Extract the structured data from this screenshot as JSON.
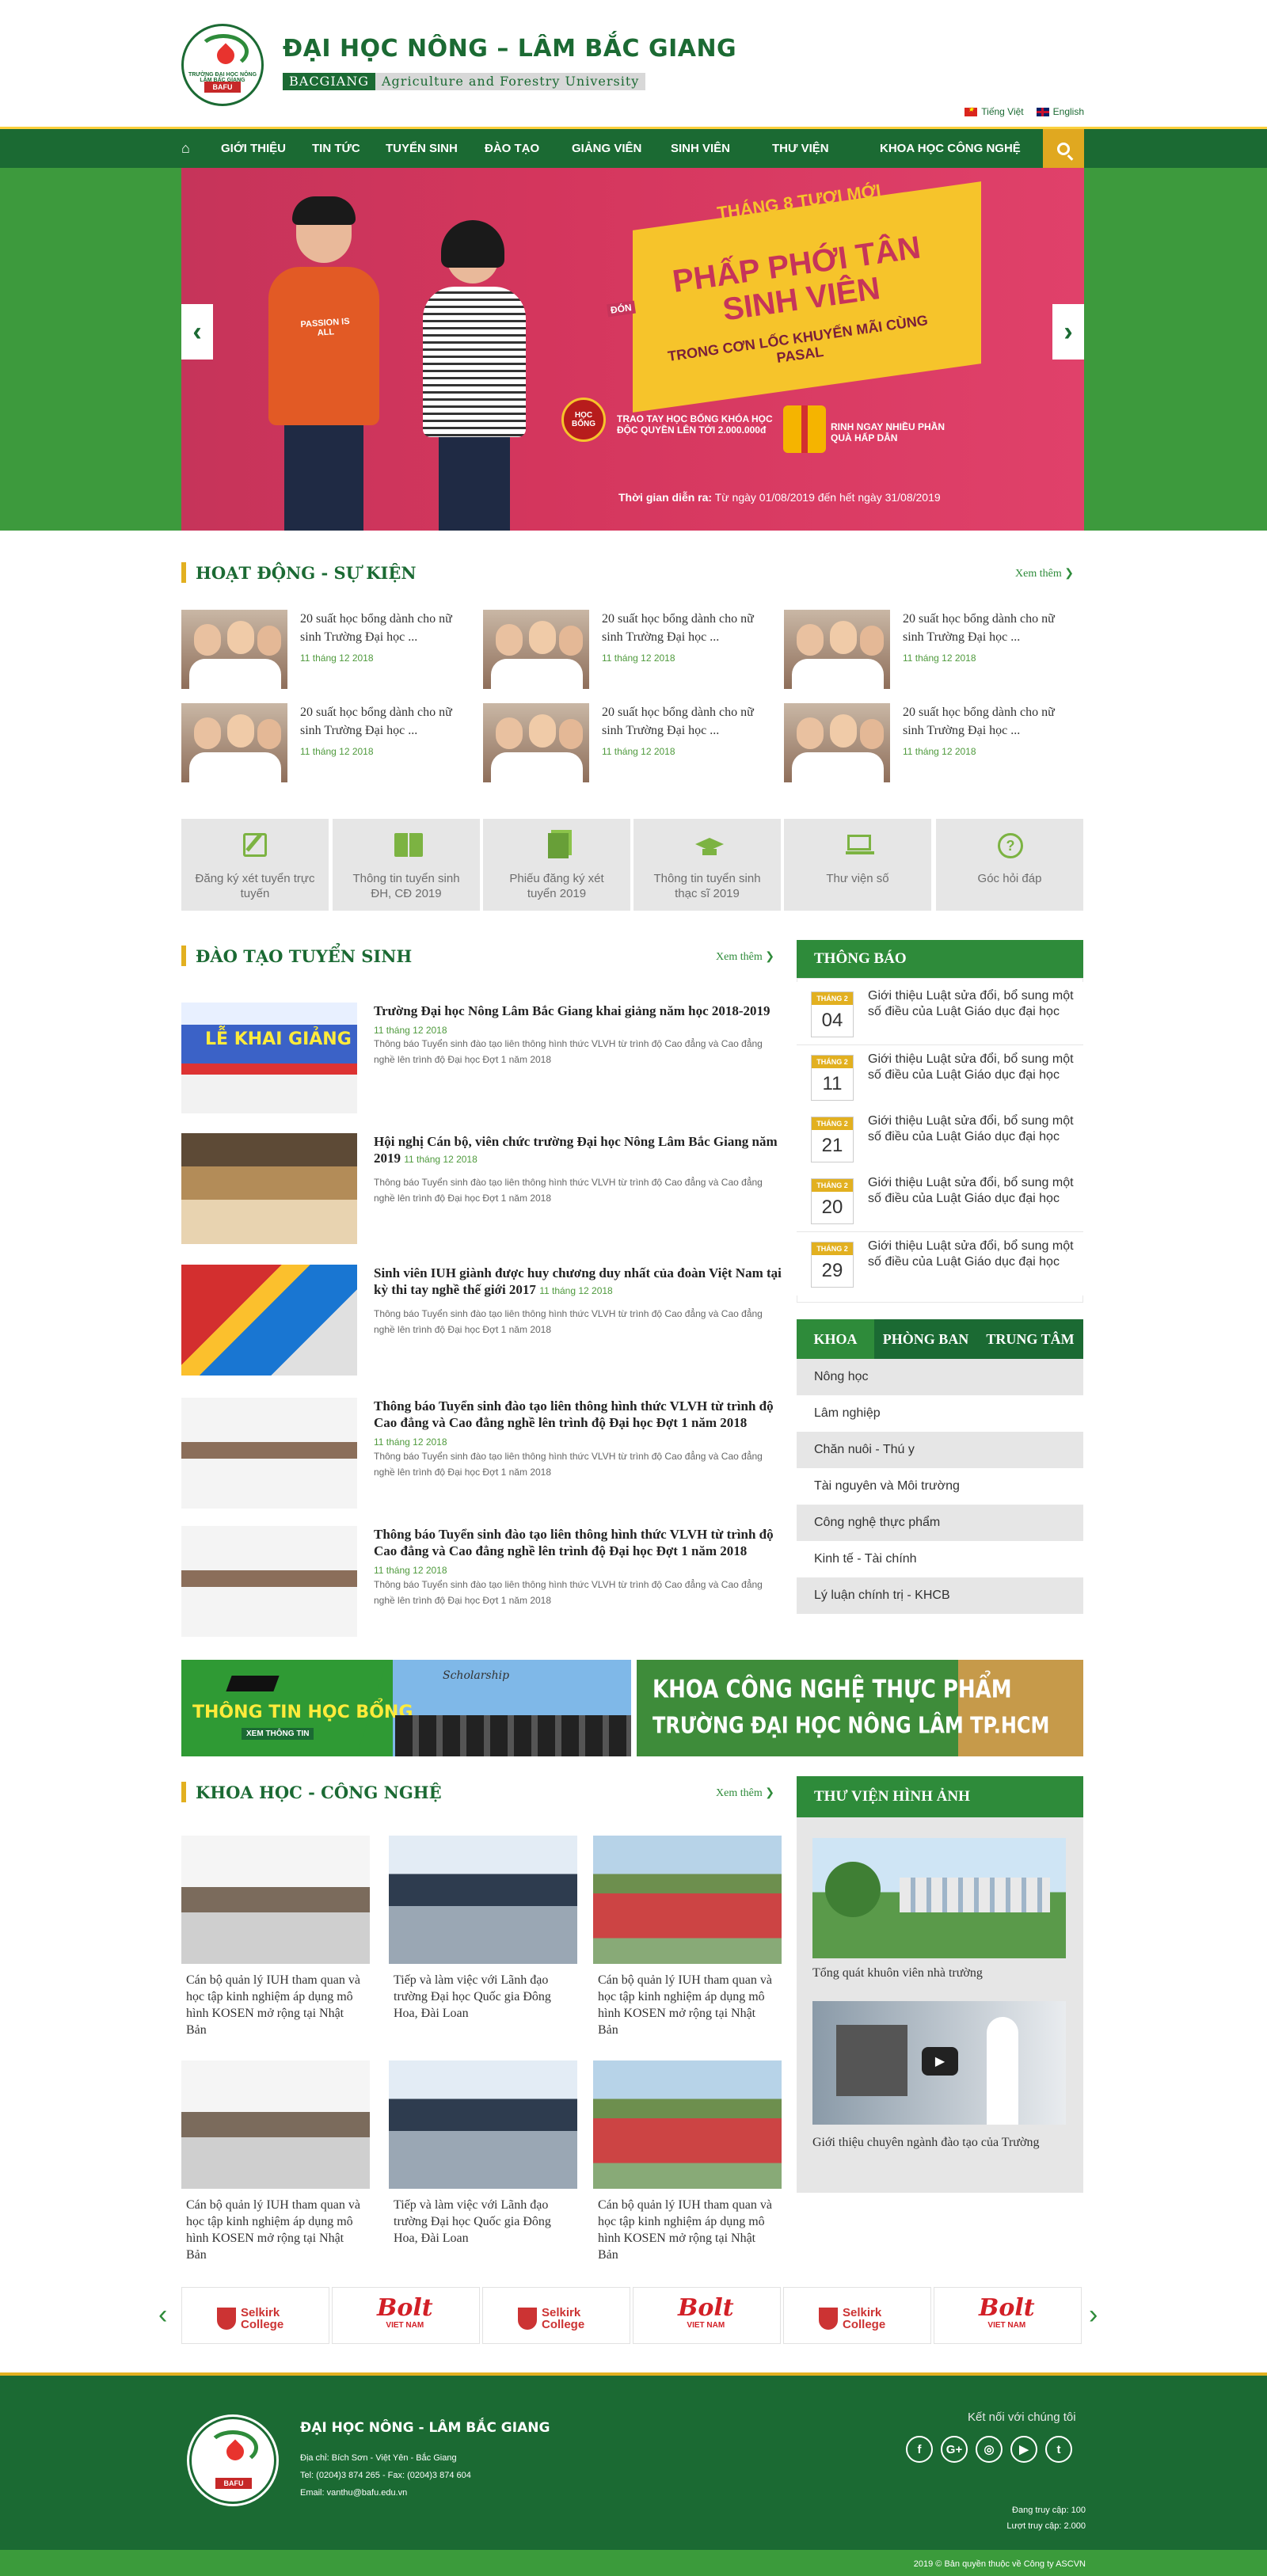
{
  "header": {
    "title": "ĐẠI HỌC NÔNG – LÂM BẮC GIANG",
    "subtitle_key": "BACGIANG",
    "subtitle_value": "Agriculture and Forestry University",
    "logo_text": "TRƯỜNG ĐẠI HỌC NÔNG LÂM BẮC GIANG",
    "logo_badge": "BAFU",
    "languages": [
      {
        "label": "Tiếng Việt",
        "icon": "vn-flag-icon"
      },
      {
        "label": "English",
        "icon": "uk-flag-icon"
      }
    ]
  },
  "nav": {
    "items": [
      "GIỚI THIỆU",
      "TIN TỨC",
      "TUYỂN SINH",
      "ĐÀO TẠO",
      "GIẢNG VIÊN",
      "SINH VIÊN",
      "THƯ VIỆN",
      "KHOA HỌC CÔNG NGHỆ"
    ],
    "colors": {
      "bar": "#1b6a33",
      "accent": "#e0a820"
    }
  },
  "slider": {
    "line1": "THÁNG 8 TƯƠI MỚI",
    "line2": "PHẤP PHỚI TÂN SINH VIÊN",
    "line2_prefix": "ĐÓN",
    "line3": "TRONG CƠN LỐC KHUYẾN MÃI CÙNG PASAL",
    "promo1": "TRAO TAY HỌC BỔNG KHÓA HỌC ĐỘC QUYỀN LÊN TỚI 2.000.000đ",
    "promo2": "RINH NGAY NHIỀU PHẦN QUÀ HẤP DẪN",
    "shirt_text": "PASSION IS ALL",
    "seal_text": "HỌC BỔNG",
    "time_label": "Thời gian diễn ra:",
    "time_value": "Từ ngày 01/08/2019 đến hết ngày 31/08/2019"
  },
  "events": {
    "heading": "HOẠT ĐỘNG - SỰ KIỆN",
    "more": "Xem thêm",
    "items": [
      {
        "title": "20 suất học bổng dành cho nữ sinh Trường Đại học ...",
        "date": "11 tháng 12 2018"
      },
      {
        "title": "20 suất học bổng dành cho nữ sinh Trường Đại học ...",
        "date": "11 tháng 12 2018"
      },
      {
        "title": "20 suất học bổng dành cho nữ sinh Trường Đại học ...",
        "date": "11 tháng 12 2018"
      },
      {
        "title": "20 suất học bổng dành cho nữ sinh Trường Đại học ...",
        "date": "11 tháng 12 2018"
      },
      {
        "title": "20 suất học bổng dành cho nữ sinh Trường Đại học ...",
        "date": "11 tháng 12 2018"
      },
      {
        "title": "20 suất học bổng dành cho nữ sinh Trường Đại học ...",
        "date": "11 tháng 12 2018"
      }
    ]
  },
  "quick_links": [
    {
      "label": "Đăng ký xét tuyển trực tuyến",
      "icon": "edit-icon"
    },
    {
      "label": "Thông tin tuyển sinh ĐH, CĐ 2019",
      "icon": "book-icon"
    },
    {
      "label": "Phiếu đăng ký xét tuyển 2019",
      "icon": "books-icon"
    },
    {
      "label": "Thông tin tuyển sinh thạc sĩ 2019",
      "icon": "graduation-cap-icon"
    },
    {
      "label": "Thư viện số",
      "icon": "laptop-icon"
    },
    {
      "label": "Góc hỏi đáp",
      "icon": "question-icon"
    }
  ],
  "training": {
    "heading": "ĐÀO TẠO TUYỂN SINH",
    "more": "Xem thêm",
    "items": [
      {
        "title": "Trường Đại học Nông Lâm Bắc Giang khai giảng năm học 2018-2019",
        "date": "11 tháng 12 2018",
        "desc": "Thông báo Tuyển sinh đào tạo liên thông hình thức VLVH từ trình độ Cao đẳng và Cao đẳng nghề lên trình độ Đại học Đợt 1 năm 2018"
      },
      {
        "title": "Hội nghị Cán bộ, viên chức trường Đại học Nông Lâm Bắc Giang năm 2019",
        "date": "11 tháng 12 2018",
        "desc": "Thông báo Tuyển sinh đào tạo liên thông hình thức VLVH từ trình độ Cao đẳng và Cao đẳng nghề lên trình độ Đại học Đợt 1 năm 2018"
      },
      {
        "title": "Sinh viên IUH giành được huy chương duy nhất của đoàn Việt Nam tại kỳ thi tay nghề thế giới 2017",
        "date": "11 tháng 12 2018",
        "desc": "Thông báo Tuyển sinh đào tạo liên thông hình thức VLVH từ trình độ Cao đẳng và Cao đẳng nghề lên trình độ Đại học Đợt 1 năm 2018"
      },
      {
        "title": "Thông báo Tuyển sinh đào tạo liên thông hình thức VLVH từ trình độ Cao đẳng và Cao đẳng nghề lên trình độ Đại học Đợt 1 năm 2018",
        "date": "11 tháng 12 2018",
        "desc": "Thông báo Tuyển sinh đào tạo liên thông hình thức VLVH từ trình độ Cao đẳng và Cao đẳng nghề lên trình độ Đại học Đợt 1 năm 2018"
      },
      {
        "title": "Thông báo Tuyển sinh đào tạo liên thông hình thức VLVH từ trình độ Cao đẳng và Cao đẳng nghề lên trình độ Đại học Đợt 1 năm 2018",
        "date": "11 tháng 12 2018",
        "desc": "Thông báo Tuyển sinh đào tạo liên thông hình thức VLVH từ trình độ Cao đẳng và Cao đẳng nghề lên trình độ Đại học Đợt 1 năm 2018"
      }
    ],
    "slide_title": "LỄ KHAI GIẢNG"
  },
  "notices": {
    "heading": "THÔNG BÁO",
    "items": [
      {
        "month": "THÁNG 2",
        "day": "04",
        "text": "Giới thiệu Luật sửa đổi, bổ sung một số điều của Luật Giáo dục đại học"
      },
      {
        "month": "THÁNG 2",
        "day": "11",
        "text": "Giới thiệu Luật sửa đổi, bổ sung một số điều của Luật Giáo dục đại học"
      },
      {
        "month": "THÁNG 2",
        "day": "21",
        "text": "Giới thiệu Luật sửa đổi, bổ sung một số điều của Luật Giáo dục đại học"
      },
      {
        "month": "THÁNG 2",
        "day": "20",
        "text": "Giới thiệu Luật sửa đổi, bổ sung một số điều của Luật Giáo dục đại học"
      },
      {
        "month": "THÁNG 2",
        "day": "29",
        "text": "Giới thiệu Luật sửa đổi, bổ sung một số điều của Luật Giáo dục đại học"
      }
    ]
  },
  "faculty_tabs": {
    "tabs": [
      "KHOA",
      "PHÒNG BAN",
      "TRUNG TÂM"
    ],
    "items": [
      "Nông học",
      "Lâm nghiệp",
      "Chăn nuôi - Thú y",
      "Tài nguyên và Môi trường",
      "Công nghệ thực phẩm",
      "Kinh tế - Tài chính",
      "Lý luận chính trị - KHCB"
    ]
  },
  "ad_banners": {
    "left_title": "THÔNG TIN HỌC BỔNG",
    "left_sub": "XEM THÔNG TIN",
    "left_brand": "Scholarship",
    "right_line1": "KHOA CÔNG NGHỆ THỰC PHẨM",
    "right_line2": "TRƯỜNG ĐẠI HỌC NÔNG LÂM TP.HCM"
  },
  "science": {
    "heading": "KHOA HỌC - CÔNG NGHỆ",
    "more": "Xem thêm",
    "items": [
      {
        "title": "Cán bộ quản lý IUH tham quan và học tập kinh nghiệm áp dụng mô hình KOSEN mở rộng tại Nhật Bản"
      },
      {
        "title": "Tiếp và làm việc với Lãnh đạo trường Đại học Quốc gia Đông Hoa, Đài Loan"
      },
      {
        "title": "Cán bộ quản lý IUH tham quan và học tập kinh nghiệm áp dụng mô hình KOSEN mở rộng tại Nhật Bản"
      },
      {
        "title": "Cán bộ quản lý IUH tham quan và học tập kinh nghiệm áp dụng mô hình KOSEN mở rộng tại Nhật Bản"
      },
      {
        "title": "Tiếp và làm việc với Lãnh đạo trường Đại học Quốc gia Đông Hoa, Đài Loan"
      },
      {
        "title": "Cán bộ quản lý IUH tham quan và học tập kinh nghiệm áp dụng mô hình KOSEN mở rộng tại Nhật Bản"
      }
    ]
  },
  "gallery": {
    "heading": "THƯ VIỆN HÌNH ẢNH",
    "items": [
      {
        "title": "Tổng quát khuôn viên nhà trường"
      },
      {
        "title": "Giới thiệu chuyên ngành đào tạo của Trường"
      }
    ]
  },
  "partners": {
    "items": [
      {
        "brand": "Selkirk College",
        "line1": "Selkirk",
        "line2": "College"
      },
      {
        "brand": "Bolt Việt Nam",
        "line1": "Bolt",
        "line2": "VIET NAM"
      },
      {
        "brand": "Selkirk College",
        "line1": "Selkirk",
        "line2": "College"
      },
      {
        "brand": "Bolt Việt Nam",
        "line1": "Bolt",
        "line2": "VIET NAM"
      },
      {
        "brand": "Selkirk College",
        "line1": "Selkirk",
        "line2": "College"
      },
      {
        "brand": "Bolt Việt Nam",
        "line1": "Bolt",
        "line2": "VIET NAM"
      }
    ]
  },
  "footer": {
    "title": "ĐẠI HỌC NÔNG - LÂM BẮC GIANG",
    "address": "Địa chỉ: Bích Sơn - Việt Yên - Bắc Giang",
    "phone": "Tel: (0204)3 874 265 - Fax: (0204)3 874 604",
    "email": "Email: vanthu@bafu.edu.vn",
    "connect": "Kết nối với chúng tôi",
    "social": [
      {
        "icon": "facebook-icon",
        "glyph": "f"
      },
      {
        "icon": "google-plus-icon",
        "glyph": "G+"
      },
      {
        "icon": "instagram-icon",
        "glyph": "◎"
      },
      {
        "icon": "youtube-icon",
        "glyph": "▶"
      },
      {
        "icon": "twitter-icon",
        "glyph": "t"
      }
    ],
    "online": "Đang truy cập: 100",
    "visits": "Lượt truy cập: 2.000",
    "copyright": "2019 © Bản quyền thuộc về Công ty ASCVN"
  }
}
